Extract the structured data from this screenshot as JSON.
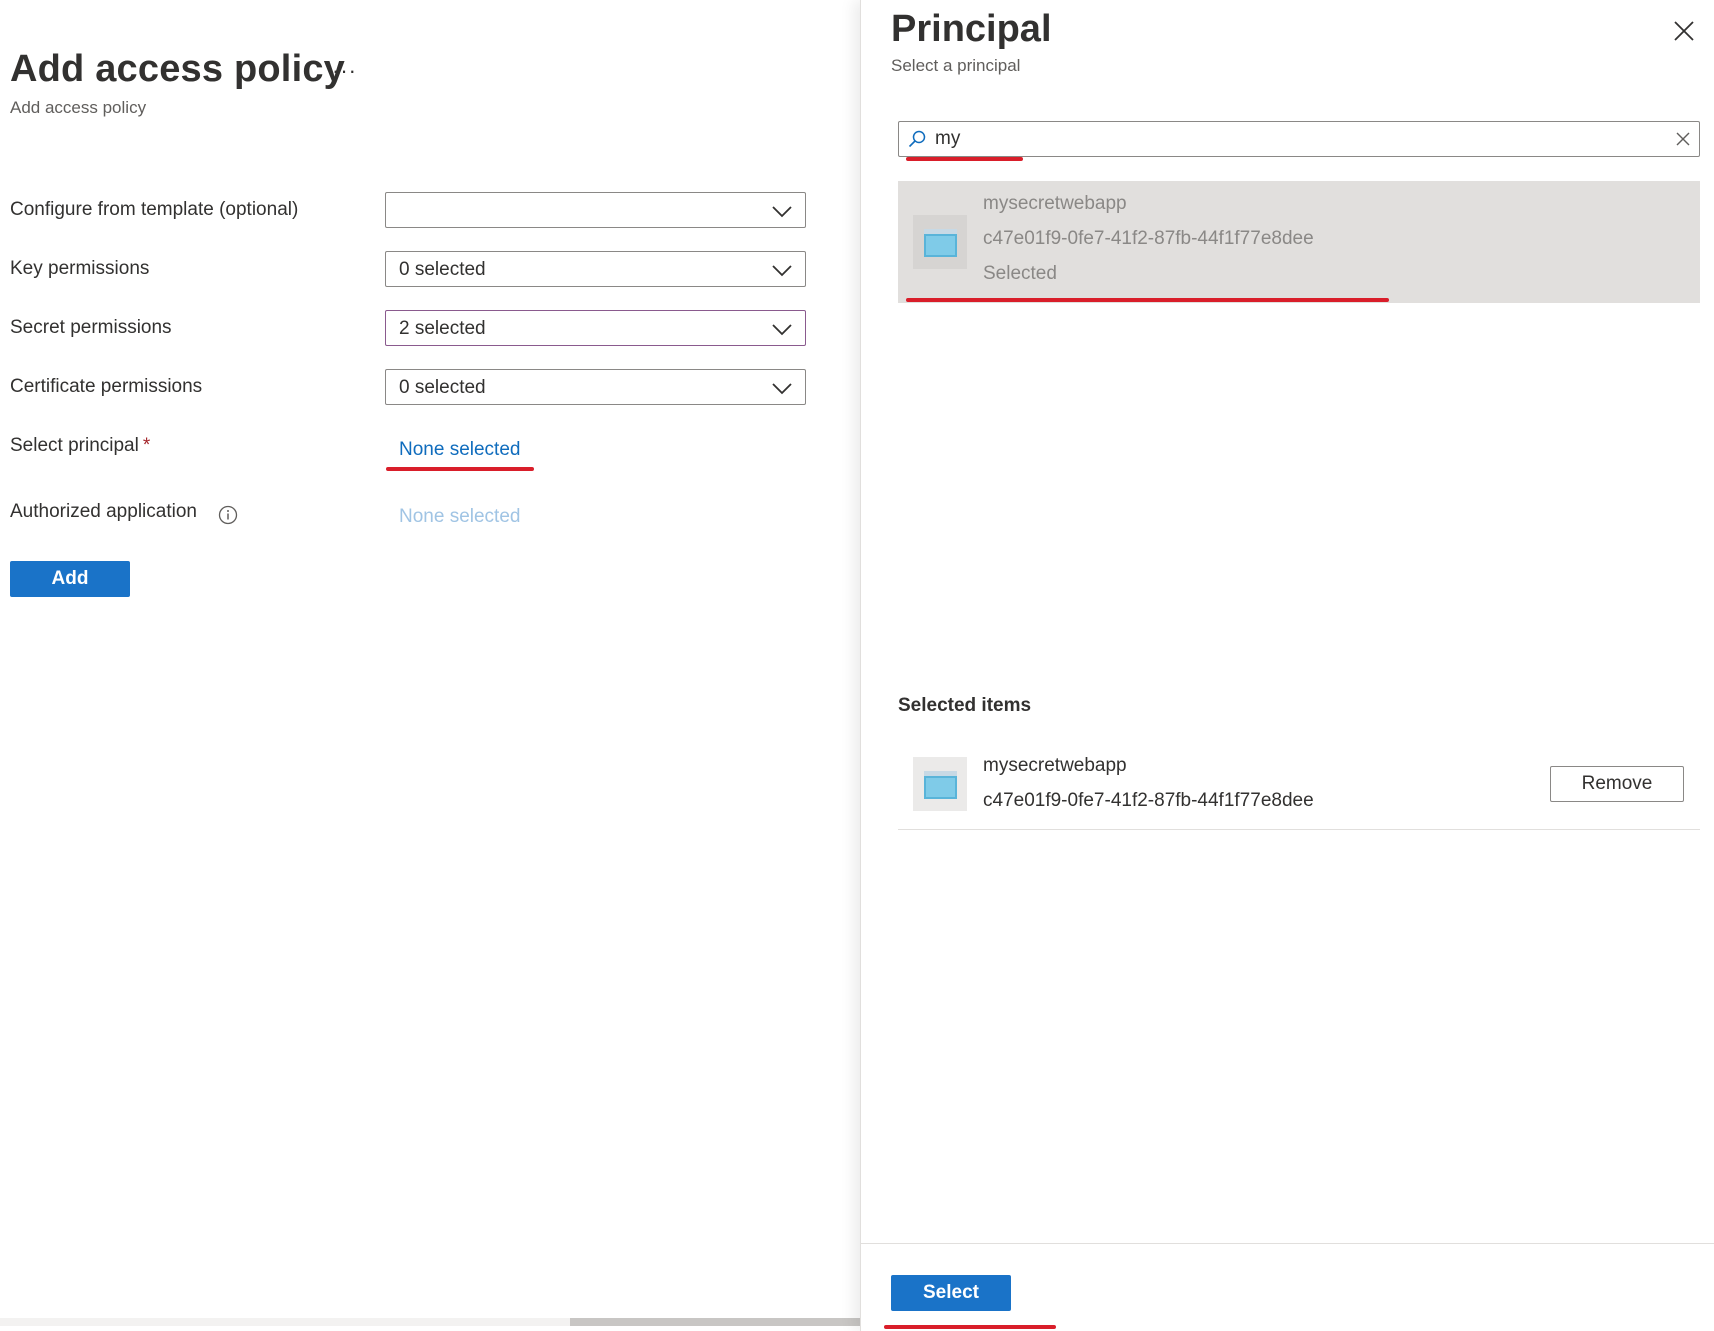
{
  "left_blade": {
    "title": "Add access policy",
    "more_label": "···",
    "subtitle": "Add access policy",
    "form": {
      "template": {
        "label": "Configure from template (optional)",
        "value": ""
      },
      "key_permissions": {
        "label": "Key permissions",
        "value": "0 selected"
      },
      "secret_permissions": {
        "label": "Secret permissions",
        "value": "2 selected"
      },
      "certificate_permissions": {
        "label": "Certificate permissions",
        "value": "0 selected"
      },
      "select_principal": {
        "label": "Select principal",
        "required_mark": "*",
        "value": "None selected"
      },
      "authorized_application": {
        "label": "Authorized application",
        "value": "None selected"
      }
    },
    "add_button": "Add"
  },
  "principal_panel": {
    "title": "Principal",
    "subtitle": "Select a principal",
    "search": {
      "value": "my",
      "placeholder": ""
    },
    "results": [
      {
        "name": "mysecretwebapp",
        "id": "c47e01f9-0fe7-41f2-87fb-44f1f77e8dee",
        "status": "Selected"
      }
    ],
    "selected_heading": "Selected items",
    "selected_items": [
      {
        "name": "mysecretwebapp",
        "id": "c47e01f9-0fe7-41f2-87fb-44f1f77e8dee",
        "remove_label": "Remove"
      }
    ],
    "select_button": "Select"
  },
  "colors": {
    "primary": "#1a73c8",
    "link": "#0f6cbd",
    "annotation_red": "#d91e2a",
    "selected_row_bg": "#e1dfdd"
  }
}
